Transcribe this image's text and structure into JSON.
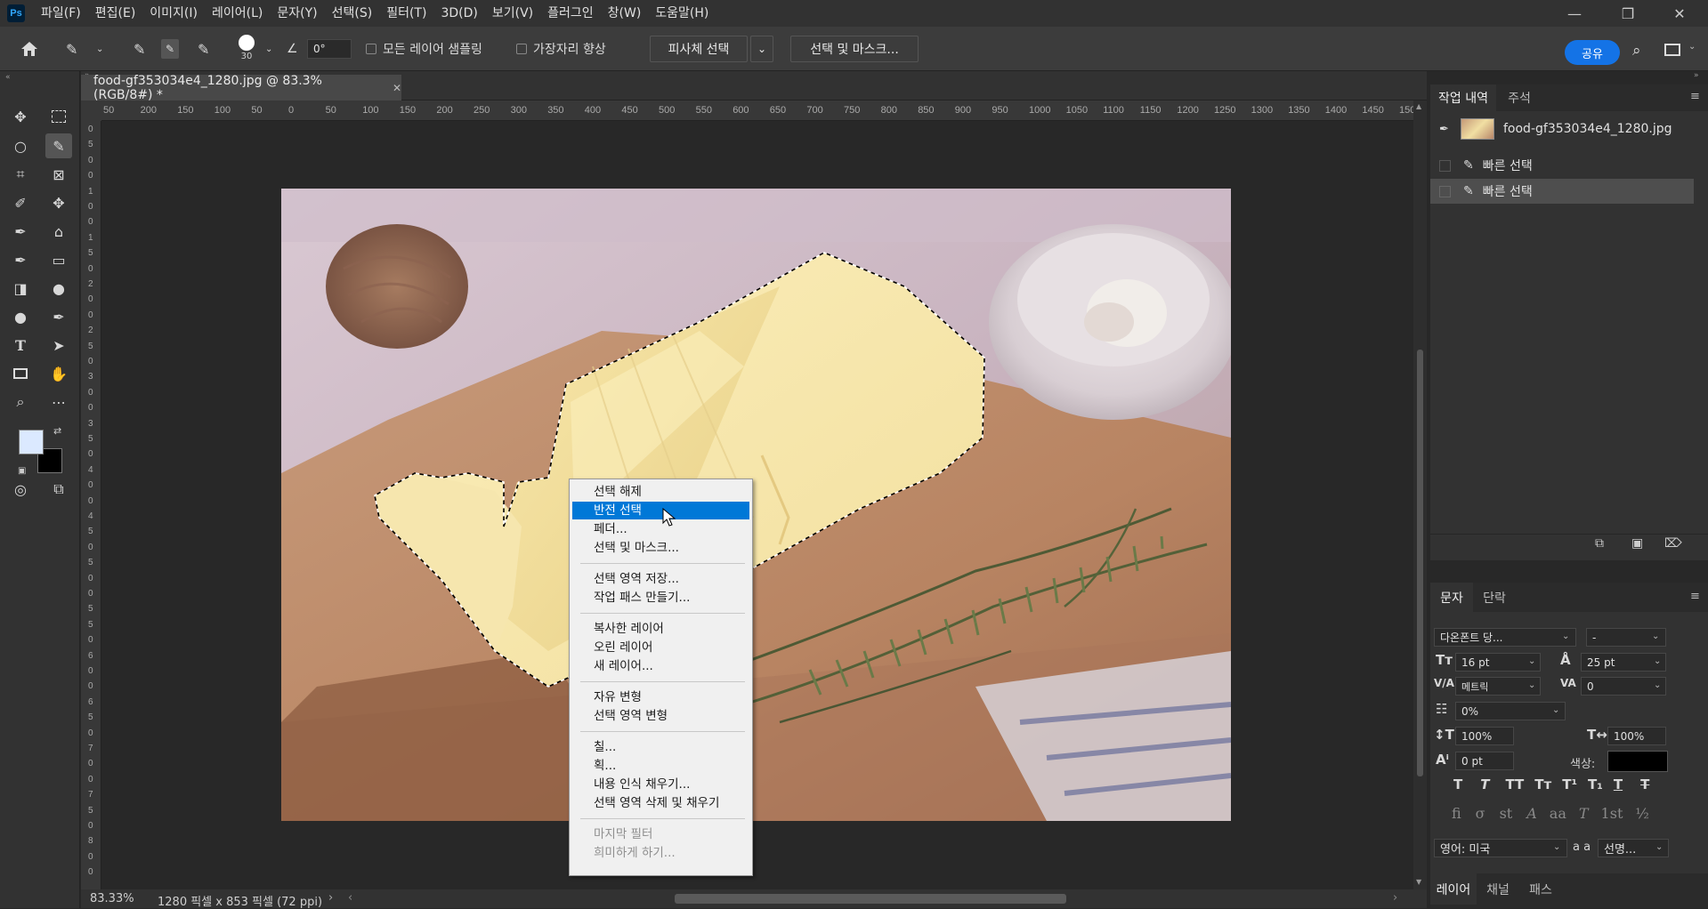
{
  "app": {
    "logo": "Ps"
  },
  "menu": [
    "파일(F)",
    "편집(E)",
    "이미지(I)",
    "레이어(L)",
    "문자(Y)",
    "선택(S)",
    "필터(T)",
    "3D(D)",
    "보기(V)",
    "플러그인",
    "창(W)",
    "도움말(H)"
  ],
  "options": {
    "brush_size": "30",
    "angle": "0°",
    "sample_all_layers": "모든 레이어 샘플링",
    "enhance_edge": "가장자리 향상",
    "select_subject": "피사체 선택",
    "select_and_mask": "선택 및 마스크...",
    "share": "공유"
  },
  "document": {
    "tab_title": "food-gf353034e4_1280.jpg @ 83.3% (RGB/8#) *",
    "zoom": "83.33%",
    "dimensions": "1280 픽셀 x 853 픽셀 (72 ppi)"
  },
  "ruler_top": [
    "50",
    "200",
    "150",
    "100",
    "50",
    "0",
    "50",
    "100",
    "150",
    "200",
    "250",
    "300",
    "350",
    "400",
    "450",
    "500",
    "550",
    "600",
    "650",
    "700",
    "750",
    "800",
    "850",
    "900",
    "950",
    "1000",
    "1050",
    "1100",
    "1150",
    "1200",
    "1250",
    "1300",
    "1350",
    "1400",
    "1450",
    "150"
  ],
  "ruler_left": [
    "0",
    "5",
    "0",
    "0",
    "1",
    "0",
    "0",
    "1",
    "5",
    "0",
    "2",
    "0",
    "0",
    "2",
    "5",
    "0",
    "3",
    "0",
    "0",
    "3",
    "5",
    "0",
    "4",
    "0",
    "0",
    "4",
    "5",
    "0",
    "5",
    "0",
    "0",
    "5",
    "5",
    "0",
    "6",
    "0",
    "0",
    "6",
    "5",
    "0",
    "7",
    "0",
    "0",
    "7",
    "5",
    "0",
    "8",
    "0",
    "0"
  ],
  "context_menu": {
    "groups": [
      [
        "선택 해제",
        "반전 선택",
        "페더...",
        "선택 및 마스크..."
      ],
      [
        "선택 영역 저장...",
        "작업 패스 만들기..."
      ],
      [
        "복사한 레이어",
        "오린 레이어",
        "새 레이어..."
      ],
      [
        "자유 변형",
        "선택 영역 변형"
      ],
      [
        "칠...",
        "획...",
        "내용 인식 채우기...",
        "선택 영역 삭제 및 채우기"
      ],
      [
        "마지막 필터",
        "희미하게 하기..."
      ]
    ],
    "highlighted": "반전 선택"
  },
  "history_panel": {
    "tabs": [
      "작업 내역",
      "주석"
    ],
    "snapshot": "food-gf353034e4_1280.jpg",
    "steps": [
      "빠른 선택",
      "빠른 선택"
    ]
  },
  "character_panel": {
    "tabs": [
      "문자",
      "단락"
    ],
    "font_family": "다온폰트 당...",
    "font_style": "-",
    "font_size": "16 pt",
    "leading": "25 pt",
    "kerning": "메트릭",
    "tracking": "0",
    "tsume": "0%",
    "vertical_scale": "100%",
    "horizontal_scale": "100%",
    "baseline_shift": "0 pt",
    "color_label": "색상:",
    "language": "영어: 미국",
    "antialias_icon": "a a",
    "antialias": "선명..."
  },
  "bottom_tabs": [
    "레이어",
    "채널",
    "패스"
  ],
  "colors": {
    "foreground": "#dbe9ff",
    "background": "#000000",
    "accent": "#1473e6",
    "highlight": "#0078d7"
  }
}
